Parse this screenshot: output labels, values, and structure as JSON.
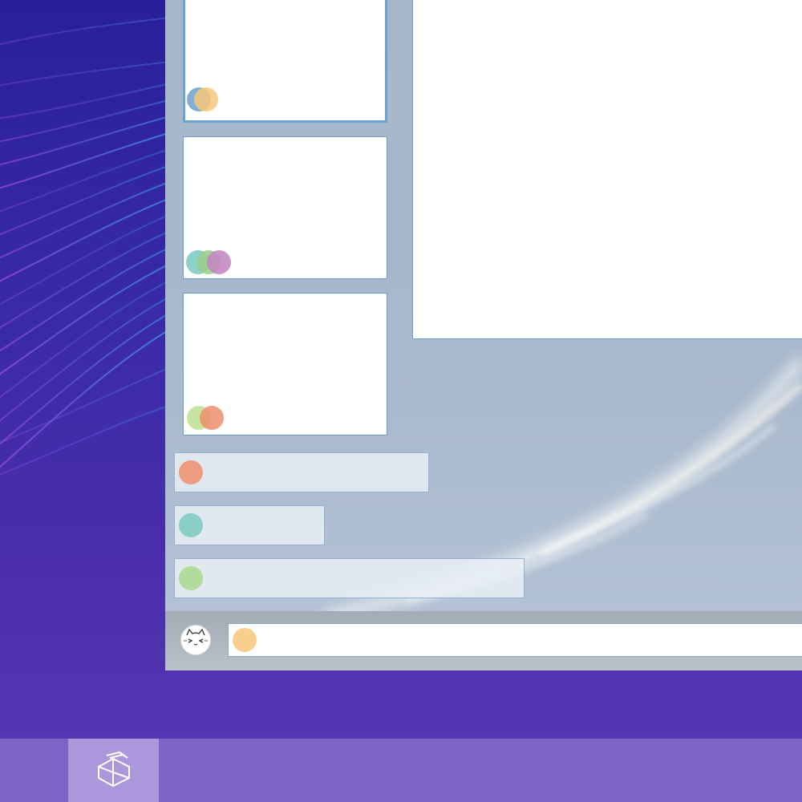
{
  "wallpaper": {
    "colors": [
      "#2a1f9a",
      "#5b38b4"
    ],
    "accent_lines": [
      "#3aa8e8",
      "#b04be0"
    ]
  },
  "app_window": {
    "thumbnails": [
      {
        "selected": true,
        "dots": [
          "#6f9fd0",
          "#f7c778"
        ]
      },
      {
        "selected": false,
        "dots": [
          "#7ac9c1",
          "#9ccc8a",
          "#c184c1"
        ]
      },
      {
        "selected": false,
        "dots": [
          "#bde08f",
          "#ef8e6c"
        ]
      }
    ],
    "messages": [
      {
        "dot": "#ef8e6c"
      },
      {
        "dot": "#7ac9c1"
      },
      {
        "dot": "#a9d88c"
      }
    ],
    "input": {
      "avatar_icon": "cat-face-icon",
      "dot": "#f7c778"
    }
  },
  "taskbar": {
    "background": "#7e62c4",
    "active_button_background": "#ab98dc",
    "app_icon": "cube-stack-icon"
  }
}
